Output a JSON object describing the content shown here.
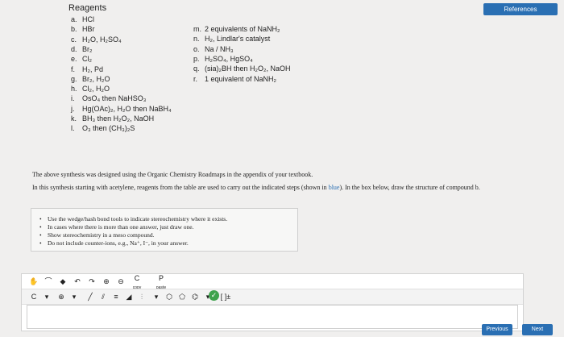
{
  "references_button": "References",
  "reagents_title": "Reagents",
  "reagents_left": [
    {
      "letter": "a.",
      "text": "HCl"
    },
    {
      "letter": "b.",
      "text": "HBr"
    },
    {
      "letter": "c.",
      "text": "H₂O, H₂SO₄"
    },
    {
      "letter": "d.",
      "text": "Br₂"
    },
    {
      "letter": "e.",
      "text": "Cl₂"
    },
    {
      "letter": "f.",
      "text": "H₂, Pd"
    },
    {
      "letter": "g.",
      "text": "Br₂, H₂O"
    },
    {
      "letter": "h.",
      "text": "Cl₂, H₂O"
    },
    {
      "letter": "i.",
      "text": "OsO₄ then NaHSO₃"
    },
    {
      "letter": "j.",
      "text": "Hg(OAc)₂, H₂O then NaBH₄"
    },
    {
      "letter": "k.",
      "text": "BH₃ then H₂O₂, NaOH"
    },
    {
      "letter": "l.",
      "text": "O₃ then (CH₃)₂S"
    }
  ],
  "reagents_right": [
    {
      "letter": "m.",
      "text": "2 equivalents of NaNH₂"
    },
    {
      "letter": "n.",
      "text": "H₂, Lindlar's catalyst"
    },
    {
      "letter": "o.",
      "text": "Na / NH₃"
    },
    {
      "letter": "p.",
      "text": "H₂SO₄, HgSO₄"
    },
    {
      "letter": "q.",
      "text": "(sia)₂BH then H₂O₂, NaOH"
    },
    {
      "letter": "r.",
      "text": "1 equivalent of NaNH₂"
    }
  ],
  "paragraph1": "The above synthesis was designed using the Organic Chemistry Roadmaps in the appendix of your textbook.",
  "paragraph2_a": "In this synthesis starting with acetylene, reagents from the table are used to carry out the indicated steps (shown in ",
  "paragraph2_blue": "blue",
  "paragraph2_b": "). In the box below, draw the structure of compound b.",
  "bullets": [
    "Use the wedge/hash bond tools to indicate stereochemistry where it exists.",
    "In cases where there is more than one answer, just draw one.",
    "Show stereochemistry in a meso compound.",
    "Do not include counter-ions, e.g., Na⁺, I⁻, in your answer."
  ],
  "toolbar": {
    "copy_label": "C",
    "paste_label": "P",
    "copy_sub": "copy",
    "paste_sub": "paste",
    "bracket_label": "[ ]±"
  },
  "nav": {
    "previous": "Previous",
    "next": "Next"
  }
}
